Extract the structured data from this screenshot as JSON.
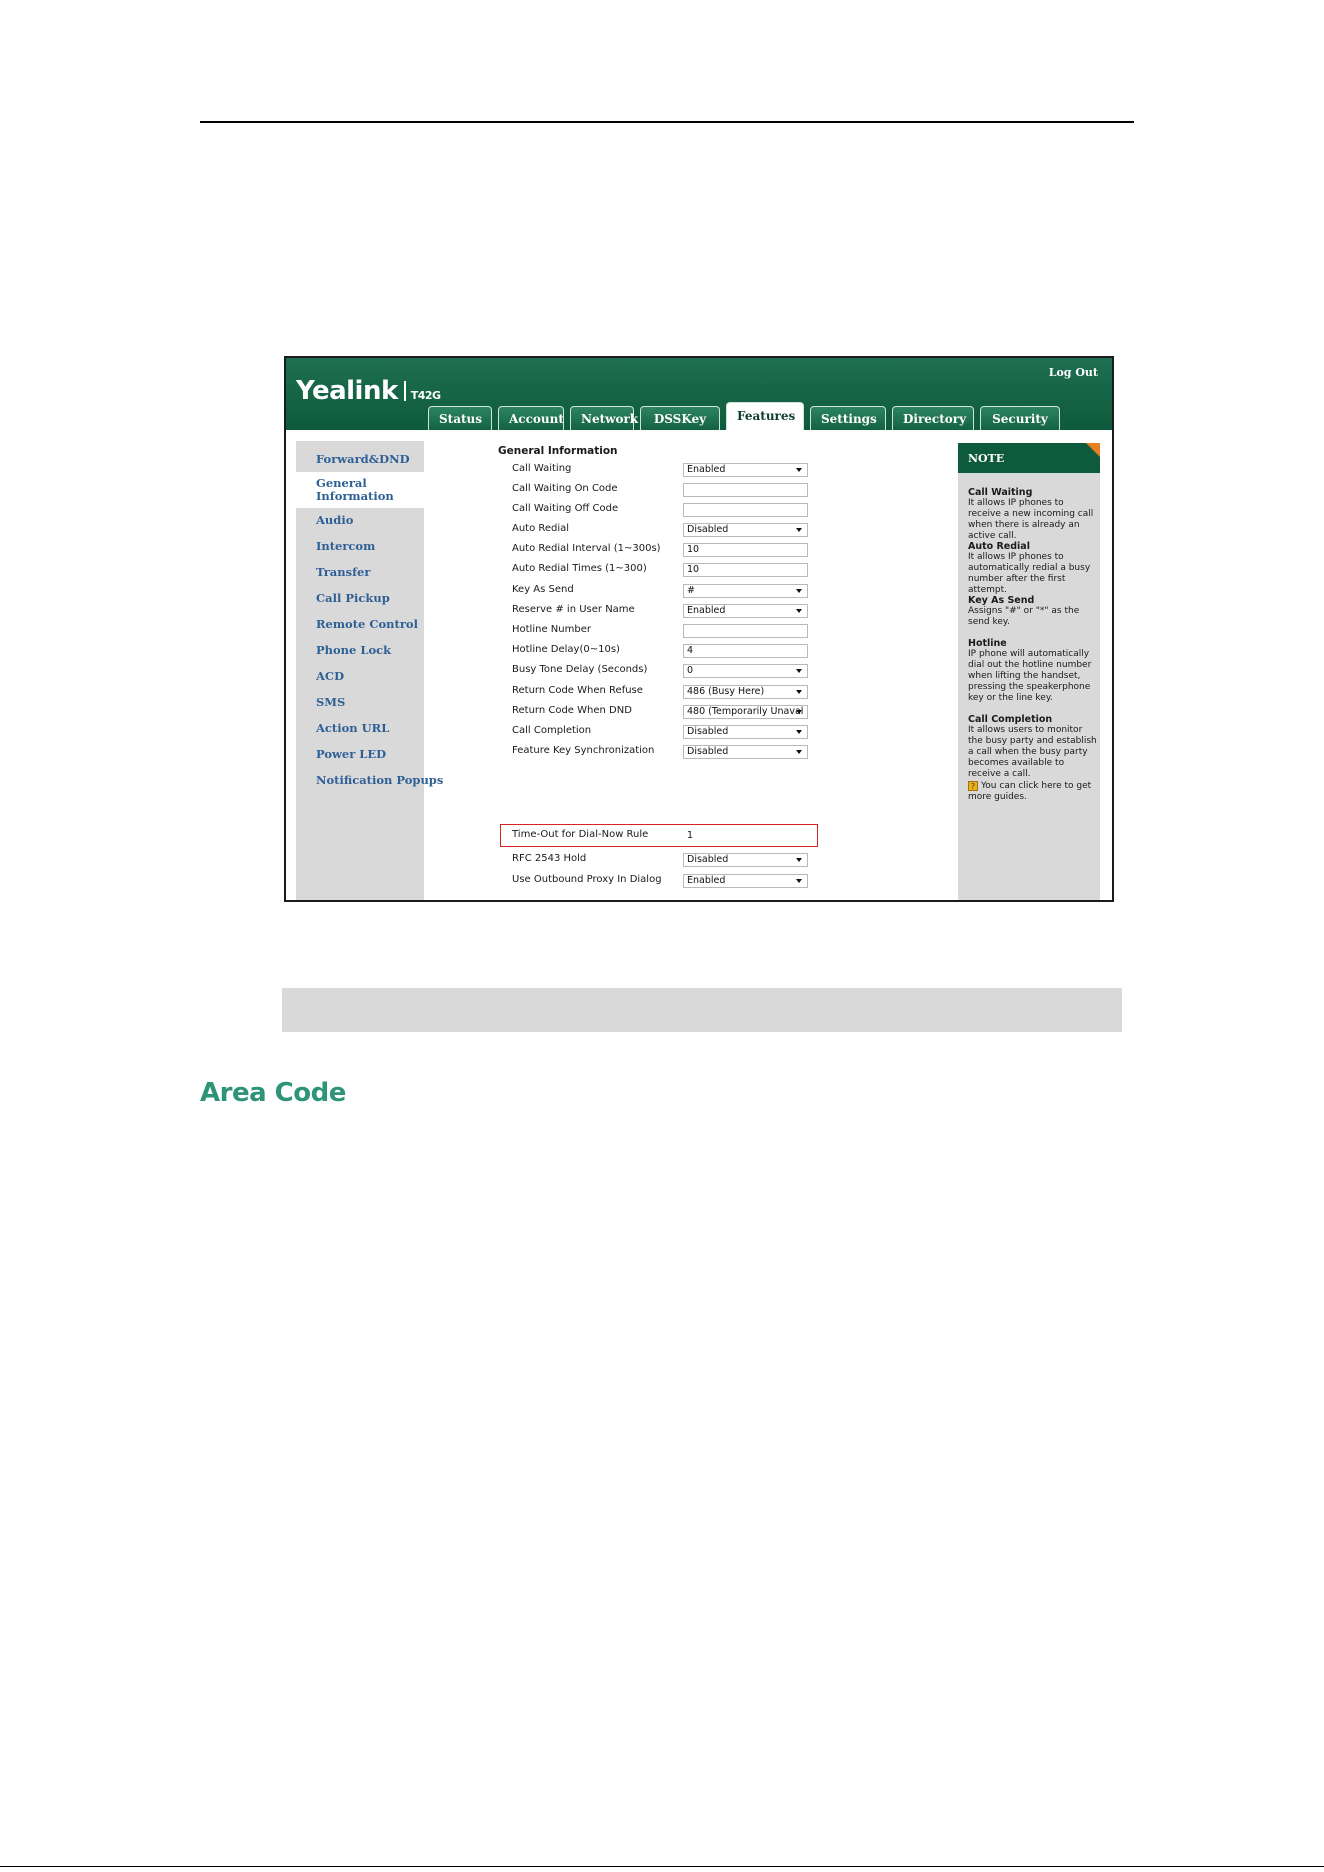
{
  "app": {
    "brand": "Yealink",
    "model": "T42G",
    "logout": "Log Out"
  },
  "tabs": [
    {
      "label": "Status"
    },
    {
      "label": "Account"
    },
    {
      "label": "Network"
    },
    {
      "label": "DSSKey"
    },
    {
      "label": "Features",
      "active": true
    },
    {
      "label": "Settings"
    },
    {
      "label": "Directory"
    },
    {
      "label": "Security"
    }
  ],
  "sidebar": {
    "items": [
      {
        "label": "Forward&DND"
      },
      {
        "label": "General Information",
        "active": true
      },
      {
        "label": "Audio"
      },
      {
        "label": "Intercom"
      },
      {
        "label": "Transfer"
      },
      {
        "label": "Call Pickup"
      },
      {
        "label": "Remote Control"
      },
      {
        "label": "Phone Lock"
      },
      {
        "label": "ACD"
      },
      {
        "label": "SMS"
      },
      {
        "label": "Action URL"
      },
      {
        "label": "Power LED"
      },
      {
        "label": "Notification Popups"
      }
    ]
  },
  "form": {
    "title": "General Information",
    "rows": [
      {
        "label": "Call Waiting",
        "value": "Enabled",
        "type": "select"
      },
      {
        "label": "Call Waiting On Code",
        "value": "",
        "type": "text"
      },
      {
        "label": "Call Waiting Off Code",
        "value": "",
        "type": "text"
      },
      {
        "label": "Auto Redial",
        "value": "Disabled",
        "type": "select"
      },
      {
        "label": "Auto Redial Interval (1~300s)",
        "value": "10",
        "type": "text"
      },
      {
        "label": "Auto Redial Times (1~300)",
        "value": "10",
        "type": "text"
      },
      {
        "label": "Key As Send",
        "value": "#",
        "type": "select"
      },
      {
        "label": "Reserve # in User Name",
        "value": "Enabled",
        "type": "select"
      },
      {
        "label": "Hotline Number",
        "value": "",
        "type": "text"
      },
      {
        "label": "Hotline Delay(0~10s)",
        "value": "4",
        "type": "text"
      },
      {
        "label": "Busy Tone Delay (Seconds)",
        "value": "0",
        "type": "select"
      },
      {
        "label": "Return Code When Refuse",
        "value": "486 (Busy Here)",
        "type": "select"
      },
      {
        "label": "Return Code When DND",
        "value": "480 (Temporarily Unaval",
        "type": "select"
      },
      {
        "label": "Call Completion",
        "value": "Disabled",
        "type": "select"
      },
      {
        "label": "Feature Key Synchronization",
        "value": "Disabled",
        "type": "select"
      },
      {
        "label": "Time-Out for Dial-Now Rule",
        "value": "1",
        "type": "text",
        "highlighted": true
      },
      {
        "label": "RFC 2543 Hold",
        "value": "Disabled",
        "type": "select"
      },
      {
        "label": "Use Outbound Proxy In Dialog",
        "value": "Enabled",
        "type": "select"
      }
    ]
  },
  "note": {
    "title": "NOTE",
    "items": [
      {
        "heading": "Call Waiting",
        "text": "It allows IP phones to receive a new incoming call when there is already an active call."
      },
      {
        "heading": "Auto Redial",
        "text": "It allows IP phones to automatically redial a busy number after the first attempt."
      },
      {
        "heading": "Key As Send",
        "text": "Assigns \"#\" or \"*\" as the send key."
      },
      {
        "heading": "Hotline",
        "text": "IP phone will automatically dial out the hotline number when lifting the handset, pressing the speakerphone key or the line key."
      },
      {
        "heading": "Call Completion",
        "text": "It allows users to monitor the busy party and establish a call when the busy party becomes available to receive a call."
      }
    ],
    "guide": "You can click here to get more guides."
  },
  "document": {
    "heading": "Area Code"
  },
  "colors": {
    "banner": "#0e5a3c",
    "nav_text": "#2e5f95",
    "highlight": "#d52525",
    "heading": "#2e9477",
    "note_corner": "#e8801f"
  }
}
